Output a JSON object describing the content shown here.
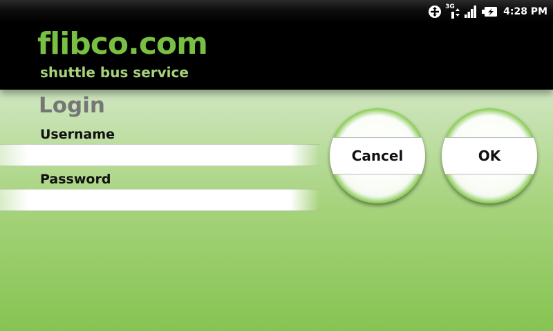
{
  "status_bar": {
    "time": "4:28 PM",
    "network_label": "3G",
    "icons": [
      "sync-icon",
      "network-3g-icon",
      "signal-bars-icon",
      "battery-charging-icon"
    ]
  },
  "header": {
    "brand": "flibco.com",
    "tagline": "shuttle bus service",
    "brand_color": "#78c043",
    "tagline_color": "#a6d27c"
  },
  "login": {
    "title": "Login",
    "username_label": "Username",
    "username_value": "",
    "password_label": "Password",
    "password_value": ""
  },
  "buttons": {
    "cancel_label": "Cancel",
    "ok_label": "OK"
  },
  "theme": {
    "accent": "#5aac26",
    "background_top": "#dcecd3",
    "background_bottom": "#86c452"
  }
}
